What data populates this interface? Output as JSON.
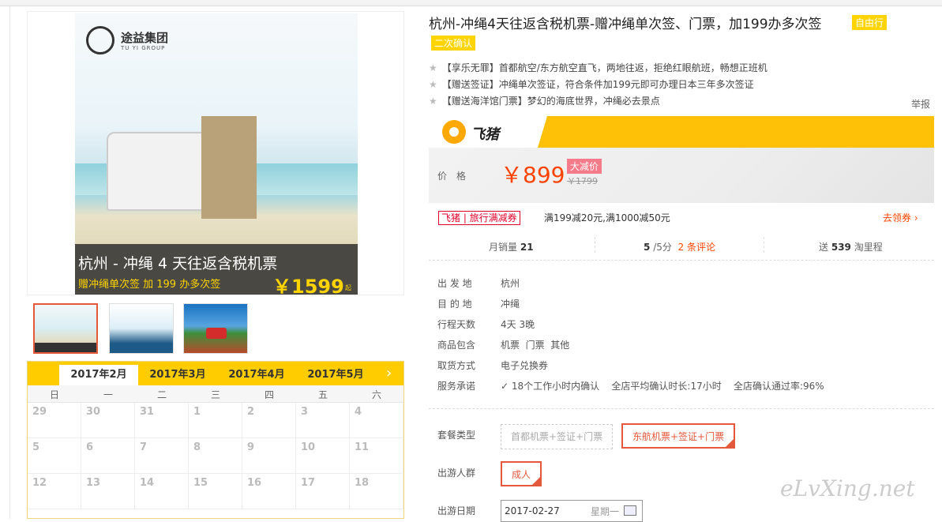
{
  "gallery": {
    "poster_logo": "途益集团",
    "poster_logo_sub": "TU YI GROUP",
    "poster_title": "杭州 - 冲绳 4 天往返含税机票",
    "poster_subtitle": "赠冲绳单次签 加 199 办多次签",
    "poster_price": "￥1599",
    "poster_price_unit": "起"
  },
  "calendar": {
    "months": [
      "2017年2月",
      "2017年3月",
      "2017年4月",
      "2017年5月"
    ],
    "weekdays": [
      "日",
      "一",
      "二",
      "三",
      "四",
      "五",
      "六"
    ],
    "days": [
      "29",
      "30",
      "31",
      "1",
      "2",
      "3",
      "4",
      "5",
      "6",
      "7",
      "8",
      "9",
      "10",
      "11",
      "12",
      "13",
      "14",
      "15",
      "16",
      "17",
      "18"
    ]
  },
  "product": {
    "title": "杭州-冲绳4天往返含税机票-赠冲绳单次签、门票，加199办多次签",
    "tag_self": "自由行",
    "tag_confirm": "二次确认",
    "features": [
      "【享乐无罪】首都航空/东方航空直飞，两地往返，拒绝红眼航班，畅想正班机",
      "【赠送签证】冲绳单次签证，符合条件加199元即可办理日本三年多次签证",
      "【赠送海洋馆门票】梦幻的海底世界，冲绳必去景点"
    ],
    "report": "举报",
    "brand": "飞猪",
    "price_label": "价格",
    "price": "￥899",
    "price_badge": "大减价",
    "orig_price": "￥1799",
    "coupon_tag": "飞猪 | 旅行满减券",
    "coupon_text": "满199减20元,满1000减50元",
    "get_coupon": "去领券 ›",
    "monthly_sales_label": "月销量",
    "monthly_sales": "21",
    "rating": "5",
    "rating_suffix": "/5分",
    "reviews": "2 条评论",
    "mileage_label": "送",
    "mileage": "539",
    "mileage_suffix": "淘里程"
  },
  "details": [
    {
      "label": "出 发 地",
      "value": "杭州"
    },
    {
      "label": "目 的 地",
      "value": "冲绳"
    },
    {
      "label": "行程天数",
      "value": "4天 3晚"
    },
    {
      "label": "商品包含",
      "value": "机票  门票  其他"
    },
    {
      "label": "取货方式",
      "value": "电子兑换券"
    },
    {
      "label": "服务承诺",
      "value": "✓ 18个工作小时内确认    全店平均确认时长:17小时    全店确认通过率:96%"
    }
  ],
  "options": {
    "package_label": "套餐类型",
    "package_a": "首都机票+签证+门票",
    "package_b": "东航机票+签证+门票",
    "people_label": "出游人群",
    "people": "成人",
    "date_label": "出游日期",
    "date_value": "2017-02-27",
    "date_week": "星期一"
  },
  "watermark": "eLvXing.net"
}
